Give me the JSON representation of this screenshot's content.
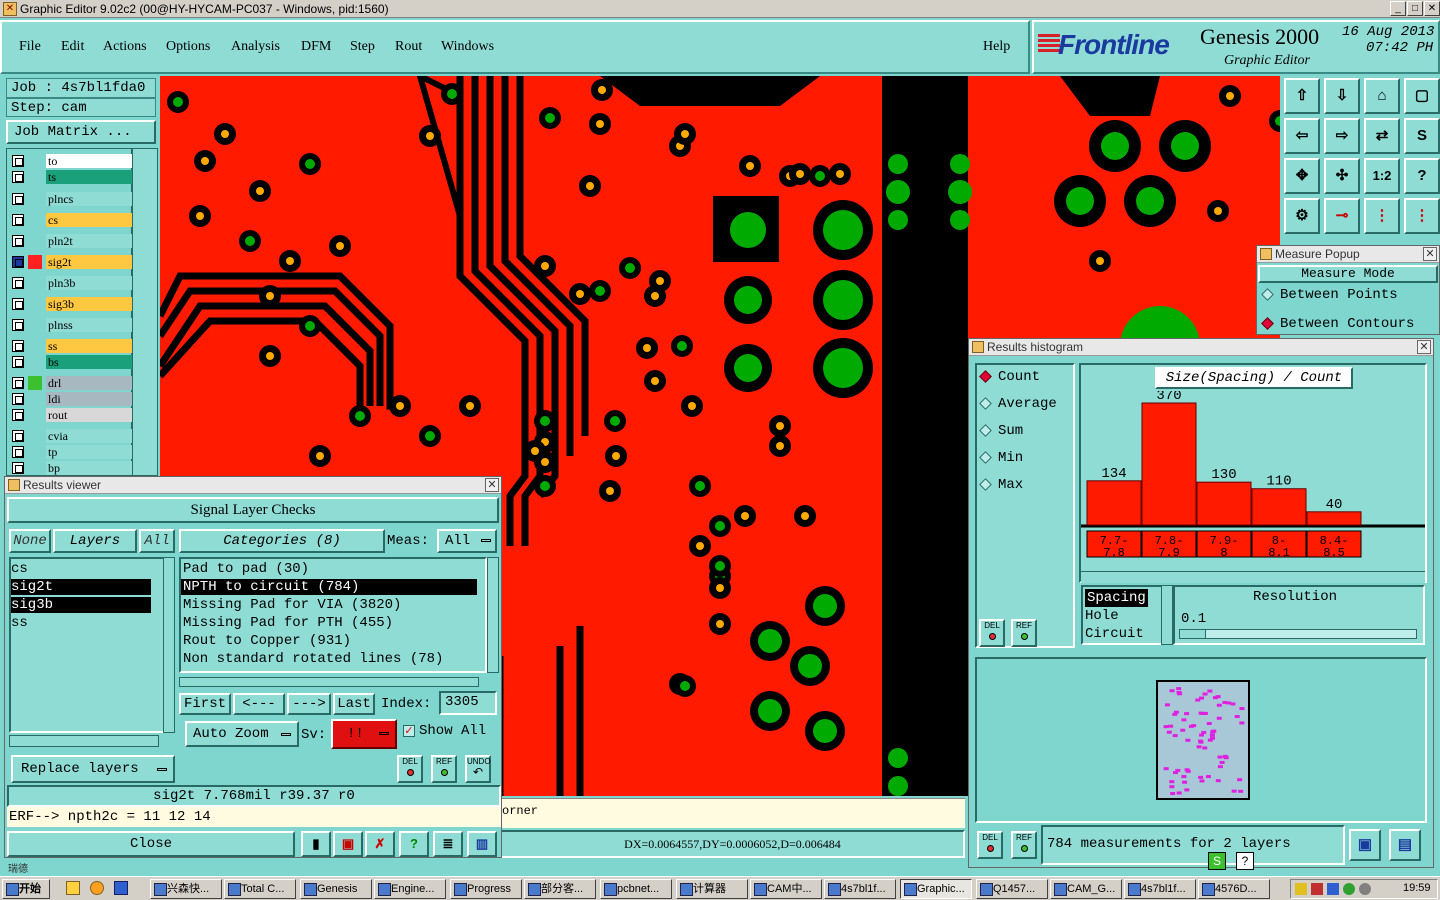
{
  "window": {
    "title": "Graphic Editor 9.02c2 (00@HY-HYCAM-PC037 - Windows, pid:1560)"
  },
  "menu": [
    "File",
    "Edit",
    "Actions",
    "Options",
    "Analysis",
    "DFM",
    "Step",
    "Rout",
    "Windows"
  ],
  "help_label": "Help",
  "brand": {
    "logo": "Frontline",
    "product": "Genesis 2000",
    "subtitle": "Graphic Editor",
    "date": "16 Aug 2013",
    "time": "07:42 PH"
  },
  "job": {
    "job": "Job : 4s7bl1fda0",
    "step": "Step: cam",
    "matrix_button": "Job Matrix ..."
  },
  "layers": [
    {
      "name": "to",
      "color": "#ffffff"
    },
    {
      "name": "ts",
      "color": "#1aa07a"
    },
    {
      "name": "plncs",
      "color": "#8fdcd5"
    },
    {
      "name": "cs",
      "color": "#ffc840"
    },
    {
      "name": "pln2t",
      "color": "#8fdcd5"
    },
    {
      "name": "sig2t",
      "color": "#ffc840"
    },
    {
      "name": "pln3b",
      "color": "#8fdcd5"
    },
    {
      "name": "sig3b",
      "color": "#ffc840"
    },
    {
      "name": "plnss",
      "color": "#8fdcd5"
    },
    {
      "name": "ss",
      "color": "#ffc840"
    },
    {
      "name": "bs",
      "color": "#1aa07a"
    },
    {
      "name": "drl",
      "color": "#a8b8c0"
    },
    {
      "name": "ldi",
      "color": "#a8b8c0"
    },
    {
      "name": "rout",
      "color": "#d8d8d8"
    },
    {
      "name": "cvia",
      "color": "#8fdcd5"
    },
    {
      "name": "tp",
      "color": "#8fdcd5"
    },
    {
      "name": "bp",
      "color": "#8fdcd5"
    }
  ],
  "colors": {
    "canvas": "#ff1a00",
    "accent": "#e0003a",
    "panel": "#8fdcd5"
  },
  "results_viewer": {
    "title": "Results viewer",
    "header": "Signal Layer Checks",
    "none_label": "None",
    "layers_label": "Layers",
    "all_label": "All",
    "layers": [
      "cs",
      "sig2t",
      "sig3b",
      "ss"
    ],
    "categories_label": "Categories (8)",
    "meas_label": "Meas:",
    "meas_value": "All",
    "categories": [
      "Pad to pad (30)",
      "NPTH to circuit (784)",
      "Missing Pad for VIA (3820)",
      "Missing Pad for PTH (455)",
      "Rout to Copper (931)",
      "Non standard rotated lines (78)"
    ],
    "first": "First",
    "prev": "<---",
    "next": "--->",
    "last": "Last",
    "index_label": "Index:",
    "index_value": "3305",
    "auto_zoom": "Auto Zoom",
    "sv_label": "Sv:",
    "sv_value": "!!",
    "show_all": "Show All",
    "replace_layers": "Replace layers",
    "status": "sig2t 7.768mil   r39.37   r0",
    "erf": "ERF--> npth2c = 11 12 14",
    "close": "Close",
    "del": "DEL",
    "ref": "REF",
    "undo": "UNDO"
  },
  "canvas_status": {
    "corner": "orner",
    "delta": "DX=0.0064557,DY=0.0006052,D=0.006484"
  },
  "measure_popup": {
    "title": "Measure Popup",
    "mode": "Measure Mode",
    "opt1": "Between Points",
    "opt2": "Between Contours"
  },
  "histogram": {
    "title": "Results histogram",
    "modes": [
      "Count",
      "Average",
      "Sum",
      "Min",
      "Max"
    ],
    "chart_title": "Size(Spacing) / Count",
    "list": [
      "Spacing",
      "Hole",
      "Circuit"
    ],
    "resolution_label": "Resolution",
    "resolution_value": "0.1",
    "summary": "784 measurements for 2 layers",
    "del": "DEL",
    "ref": "REF"
  },
  "chart_data": {
    "type": "bar",
    "title": "Size(Spacing) / Count",
    "categories": [
      "7.7-7.8",
      "7.8-7.9",
      "7.9-8",
      "8-8.1",
      "8.4-8.5"
    ],
    "values": [
      134,
      370,
      130,
      110,
      40
    ],
    "ylim": [
      0,
      370
    ]
  },
  "taskbar": {
    "start": "开始",
    "tasks": [
      "兴森快...",
      "Total C...",
      "Genesis",
      "Engine...",
      "Progress",
      "部分客...",
      "pcbnet...",
      "计算器",
      "CAM中...",
      "4s7bl1f...",
      "Graphic...",
      "Q1457...",
      "CAM_G...",
      "4s7bl1f...",
      "4576D..."
    ],
    "clock": "19:59"
  },
  "leftover": "瑞德"
}
